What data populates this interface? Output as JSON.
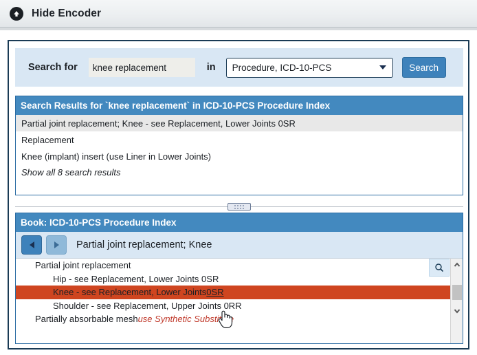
{
  "topbar": {
    "icon": "circle-up-arrow-icon",
    "title": "Hide Encoder"
  },
  "search": {
    "label": "Search for",
    "input_value": "knee replacement",
    "input_placeholder": "",
    "in_label": "in",
    "selected_option": "Procedure, ICD-10-PCS",
    "caret_icon": "chevron-down-icon",
    "button_label": "Search"
  },
  "results_panel": {
    "header": "Search Results for `knee replacement` in ICD-10-PCS Procedure Index",
    "rows": [
      "Partial joint replacement; Knee - see Replacement, Lower Joints 0SR",
      "Replacement",
      "Knee (implant) insert (use Liner in Lower Joints)"
    ],
    "show_all": "Show all 8 search results"
  },
  "splitter": {
    "grip_icon": "splitter-grip-icon"
  },
  "book_panel": {
    "header": "Book: ICD-10-PCS Procedure Index",
    "back_icon": "triangle-left-icon",
    "forward_icon": "triangle-right-icon",
    "breadcrumb": "Partial joint replacement; Knee",
    "search_icon": "magnifier-icon",
    "rows": [
      {
        "text": "Partial joint replacement",
        "level": 0,
        "selected": false
      },
      {
        "text": "Hip - see Replacement, Lower Joints 0SR",
        "level": 1,
        "selected": false
      },
      {
        "text": "Knee - see Replacement, Lower Joints ",
        "link": "0SR",
        "level": 1,
        "selected": true
      },
      {
        "text": "Shoulder - see Replacement, Upper Joints 0RR",
        "level": 1,
        "selected": false
      },
      {
        "text": "Partially absorbable mesh ",
        "note": "use Synthetic Substitute",
        "level": 0,
        "selected": false
      }
    ],
    "scrollbar": {
      "up_icon": "chevron-up-icon",
      "down_icon": "chevron-down-icon"
    }
  },
  "colors": {
    "panel_header_blue": "#4389bf",
    "accent_blue": "#3e82bb",
    "selection_orange": "#cf4520",
    "searchbar_blue": "#d9e7f4",
    "frame_border": "#1a3b55",
    "note_red": "#c0392b"
  }
}
